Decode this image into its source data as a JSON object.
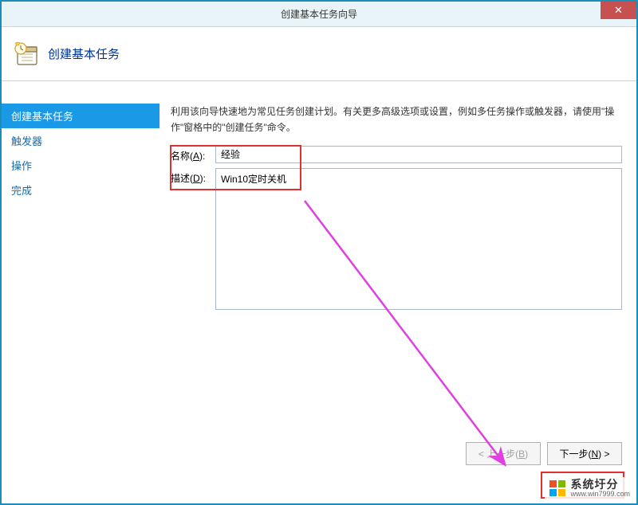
{
  "window": {
    "title": "创建基本任务向导",
    "close_symbol": "✕"
  },
  "header": {
    "title": "创建基本任务"
  },
  "sidebar": {
    "items": [
      {
        "label": "创建基本任务",
        "active": true
      },
      {
        "label": "触发器",
        "active": false
      },
      {
        "label": "操作",
        "active": false
      },
      {
        "label": "完成",
        "active": false
      }
    ]
  },
  "main": {
    "intro": "利用该向导快速地为常见任务创建计划。有关更多高级选项或设置，例如多任务操作或触发器，请使用\"操作\"窗格中的\"创建任务\"命令。",
    "name_label_pre": "名称(",
    "name_label_u": "A",
    "name_label_post": "):",
    "name_value": "经验",
    "desc_label_pre": "描述(",
    "desc_label_u": "D",
    "desc_label_post": "):",
    "desc_value": "Win10定时关机"
  },
  "footer": {
    "back_pre": "< 上一步(",
    "back_u": "B",
    "back_post": ")",
    "next_pre": "下一步(",
    "next_u": "N",
    "next_post": ") >"
  },
  "watermark": {
    "text": "系统圩分",
    "url": "www.win7999.com"
  }
}
